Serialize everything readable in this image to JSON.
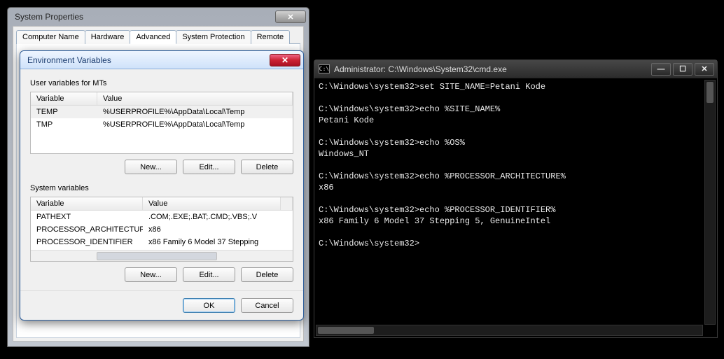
{
  "sys": {
    "title": "System Properties",
    "tabs": [
      "Computer Name",
      "Hardware",
      "Advanced",
      "System Protection",
      "Remote"
    ]
  },
  "env": {
    "title": "Environment Variables",
    "user_label": "User variables for MTs",
    "col_var": "Variable",
    "col_val": "Value",
    "user_rows": [
      {
        "name": "TEMP",
        "value": "%USERPROFILE%\\AppData\\Local\\Temp"
      },
      {
        "name": "TMP",
        "value": "%USERPROFILE%\\AppData\\Local\\Temp"
      }
    ],
    "sys_label": "System variables",
    "sys_rows": [
      {
        "name": "PATHEXT",
        "value": ".COM;.EXE;.BAT;.CMD;.VBS;.V"
      },
      {
        "name": "PROCESSOR_ARCHITECTURE",
        "value": "x86"
      },
      {
        "name": "PROCESSOR_IDENTIFIER",
        "value": "x86 Family 6 Model 37 Stepping"
      }
    ],
    "btn_new": "New...",
    "btn_edit": "Edit...",
    "btn_del": "Delete",
    "btn_ok": "OK",
    "btn_cancel": "Cancel"
  },
  "cmd": {
    "title": "Administrator: C:\\Windows\\System32\\cmd.exe",
    "icon_text": "C:\\",
    "text": "C:\\Windows\\system32>set SITE_NAME=Petani Kode\n\nC:\\Windows\\system32>echo %SITE_NAME%\nPetani Kode\n\nC:\\Windows\\system32>echo %OS%\nWindows_NT\n\nC:\\Windows\\system32>echo %PROCESSOR_ARCHITECTURE%\nx86\n\nC:\\Windows\\system32>echo %PROCESSOR_IDENTIFIER%\nx86 Family 6 Model 37 Stepping 5, GenuineIntel\n\nC:\\Windows\\system32>"
  }
}
